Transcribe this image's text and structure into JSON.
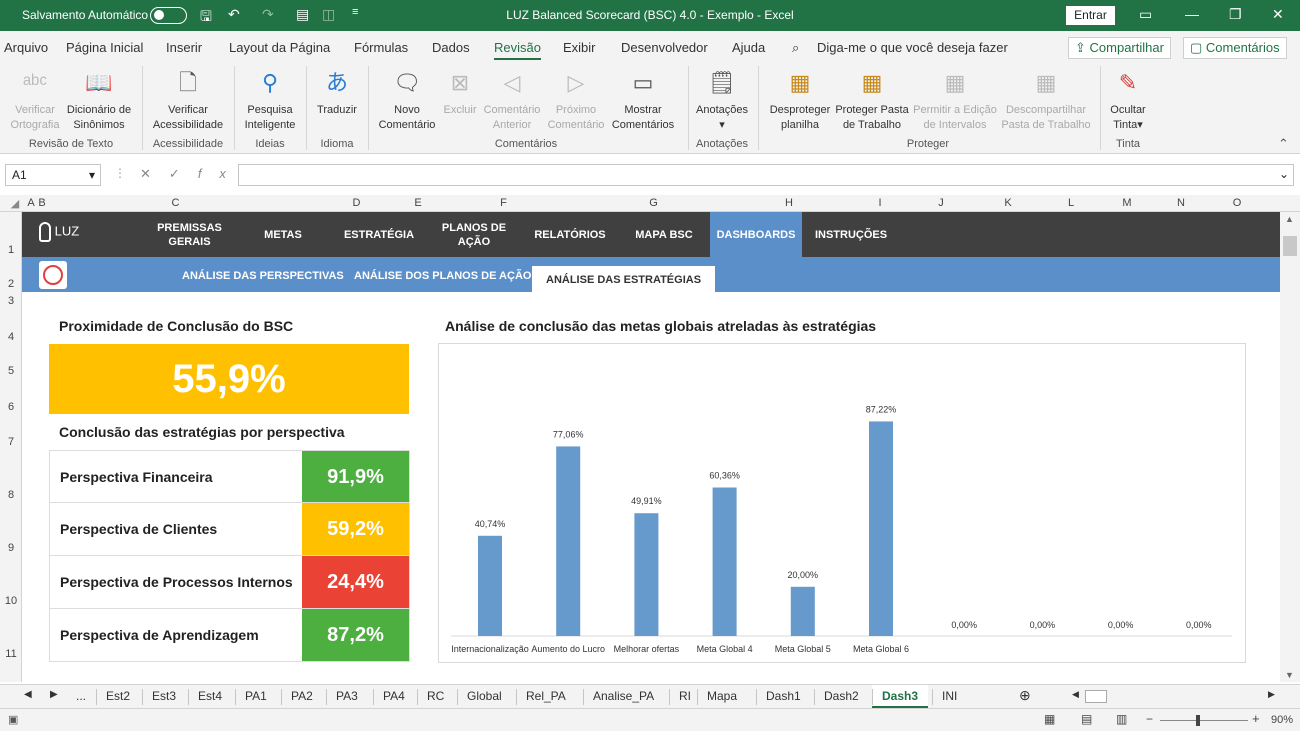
{
  "titlebar": {
    "autosave": "Salvamento Automático",
    "title": "LUZ Balanced Scorecard (BSC) 4.0 - Exemplo  -  Excel",
    "entrar": "Entrar"
  },
  "menu": [
    "Arquivo",
    "Página Inicial",
    "Inserir",
    "Layout da Página",
    "Fórmulas",
    "Dados",
    "Revisão",
    "Exibir",
    "Desenvolvedor",
    "Ajuda"
  ],
  "search_hint": "Diga-me o que você deseja fazer",
  "share": "Compartilhar",
  "comments": "Comentários",
  "ribbon": {
    "btns": [
      "Verificar Ortografia",
      "Dicionário de Sinônimos",
      "Verificar Acessibilidade",
      "Pesquisa Inteligente",
      "Traduzir",
      "Novo Comentário",
      "Excluir",
      "Comentário Anterior",
      "Próximo Comentário",
      "Mostrar Comentários",
      "Anotações",
      "Desproteger planilha",
      "Proteger Pasta de Trabalho",
      "Permitir a Edição de Intervalos",
      "Descompartilhar Pasta de Trabalho",
      "Ocultar Tinta"
    ],
    "groups": [
      "Revisão de Texto",
      "Acessibilidade",
      "Ideias",
      "Idioma",
      "Comentários",
      "Anotações",
      "Proteger",
      "Tinta"
    ]
  },
  "formula": {
    "namebox": "A1",
    "fx": "fx"
  },
  "cols": [
    "A",
    "B",
    "C",
    "D",
    "E",
    "F",
    "G",
    "H",
    "I",
    "J",
    "K",
    "L",
    "M",
    "N",
    "O"
  ],
  "rows": [
    "1",
    "2",
    "3",
    "4",
    "5",
    "6",
    "7",
    "8",
    "9",
    "10",
    "11"
  ],
  "nav": {
    "logo": "LUZ",
    "items": [
      "PREMISSAS GERAIS",
      "METAS",
      "ESTRATÉGIA",
      "PLANOS DE AÇÃO",
      "RELATÓRIOS",
      "MAPA BSC",
      "DASHBOARDS",
      "INSTRUÇÕES"
    ]
  },
  "subnav": [
    "ANÁLISE DAS PERSPECTIVAS",
    "ANÁLISE DOS PLANOS DE AÇÃO",
    "ANÁLISE DAS ESTRATÉGIAS"
  ],
  "dash": {
    "prox_title": "Proximidade de Conclusão do BSC",
    "prox_value": "55,9%",
    "persp_title": "Conclusão das estratégias por perspectiva",
    "perspectives": [
      {
        "label": "Perspectiva Financeira",
        "value": "91,9%",
        "color": "#4caf3f"
      },
      {
        "label": "Perspectiva de Clientes",
        "value": "59,2%",
        "color": "#ffc000"
      },
      {
        "label": "Perspectiva de Processos Internos",
        "value": "24,4%",
        "color": "#ea4335"
      },
      {
        "label": "Perspectiva de Aprendizagem",
        "value": "87,2%",
        "color": "#4caf3f"
      }
    ],
    "chart_title": "Análise de conclusão das metas globais atreladas às estratégias"
  },
  "chart_data": {
    "type": "bar",
    "title": "Análise de conclusão das metas globais atreladas às estratégias",
    "categories": [
      "Internacionalização",
      "Aumento do Lucro",
      "Melhorar ofertas",
      "Meta Global 4",
      "Meta Global 5",
      "Meta Global 6",
      "",
      "",
      "",
      ""
    ],
    "values": [
      40.74,
      77.06,
      49.91,
      60.36,
      20.0,
      87.22,
      0,
      0,
      0,
      0
    ],
    "labels": [
      "40,74%",
      "77,06%",
      "49,91%",
      "60,36%",
      "20,00%",
      "87,22%",
      "0,00%",
      "0,00%",
      "0,00%",
      "0,00%"
    ],
    "bar_color": "#6699cc",
    "ylim": [
      0,
      100
    ]
  },
  "tabs": [
    "Est2",
    "Est3",
    "Est4",
    "PA1",
    "PA2",
    "PA3",
    "PA4",
    "RC",
    "Global",
    "Rel_PA",
    "Analise_PA",
    "RI",
    "Mapa",
    "Dash1",
    "Dash2",
    "Dash3",
    "INI"
  ],
  "active_tab": "Dash3",
  "status": {
    "zoom": "90%"
  }
}
